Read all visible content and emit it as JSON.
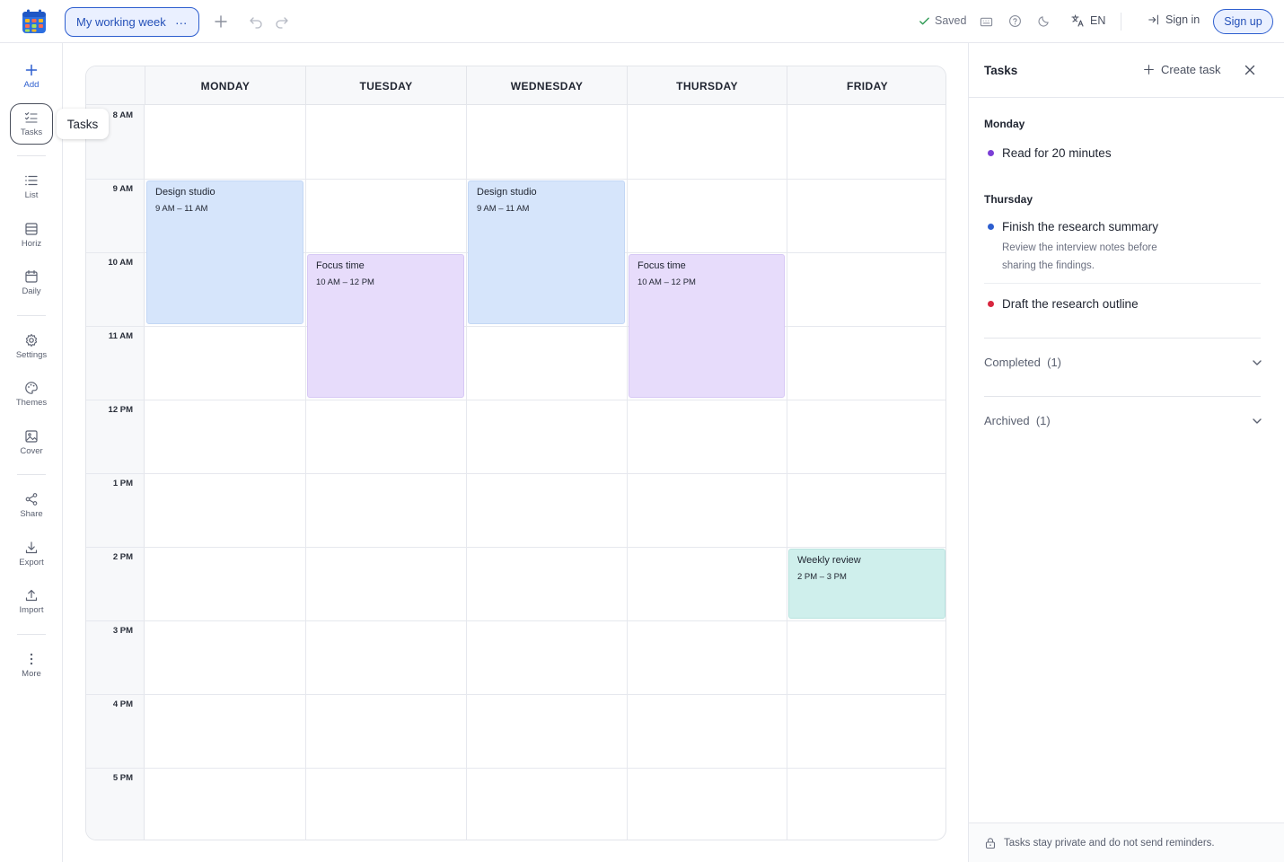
{
  "app": {
    "document_title": "My working week",
    "saved_label": "Saved",
    "language_label": "EN",
    "signin_label": "Sign in",
    "signup_label": "Sign up"
  },
  "sidebar": {
    "items": [
      {
        "label": "Add",
        "icon": "plus-icon"
      },
      {
        "label": "Tasks",
        "icon": "tasks-icon"
      },
      {
        "label": "List",
        "icon": "list-icon"
      },
      {
        "label": "Horiz",
        "icon": "horizontal-icon"
      },
      {
        "label": "Daily",
        "icon": "calendar-icon"
      },
      {
        "label": "Settings",
        "icon": "gear-icon"
      },
      {
        "label": "Themes",
        "icon": "palette-icon"
      },
      {
        "label": "Cover",
        "icon": "image-icon"
      },
      {
        "label": "Share",
        "icon": "share-icon"
      },
      {
        "label": "Export",
        "icon": "download-icon"
      },
      {
        "label": "Import",
        "icon": "upload-icon"
      },
      {
        "label": "More",
        "icon": "more-vertical-icon"
      }
    ],
    "tooltip": "Tasks"
  },
  "calendar": {
    "days": [
      "MONDAY",
      "TUESDAY",
      "WEDNESDAY",
      "THURSDAY",
      "FRIDAY"
    ],
    "hours": [
      "8 AM",
      "9 AM",
      "10 AM",
      "11 AM",
      "12 PM",
      "1 PM",
      "2 PM",
      "3 PM",
      "4 PM",
      "5 PM"
    ],
    "events": [
      {
        "day": 0,
        "start": 9,
        "end": 11,
        "title": "Design studio",
        "time": "9 AM – 11 AM",
        "color": "blue"
      },
      {
        "day": 1,
        "start": 10,
        "end": 12,
        "title": "Focus time",
        "time": "10 AM – 12 PM",
        "color": "purple"
      },
      {
        "day": 2,
        "start": 9,
        "end": 11,
        "title": "Design studio",
        "time": "9 AM – 11 AM",
        "color": "blue"
      },
      {
        "day": 3,
        "start": 10,
        "end": 12,
        "title": "Focus time",
        "time": "10 AM – 12 PM",
        "color": "purple"
      },
      {
        "day": 4,
        "start": 14,
        "end": 15,
        "title": "Weekly review",
        "time": "2 PM – 3 PM",
        "color": "teal"
      }
    ]
  },
  "tasks_panel": {
    "title": "Tasks",
    "create_label": "Create task",
    "groups": [
      {
        "label": "Monday",
        "tasks": [
          {
            "title": "Read for 20 minutes",
            "color": "#7b3fd6"
          }
        ]
      },
      {
        "label": "Thursday",
        "tasks": [
          {
            "title": "Finish the research summary",
            "color": "#2d5ecf",
            "note": "Review the interview notes before sharing the findings."
          },
          {
            "title": "Draft the research outline",
            "color": "#d8263f"
          }
        ]
      }
    ],
    "completed_label": "Completed",
    "completed_count": "(1)",
    "archived_label": "Archived",
    "archived_count": "(1)",
    "footer_note": "Tasks stay private and do not send reminders."
  }
}
